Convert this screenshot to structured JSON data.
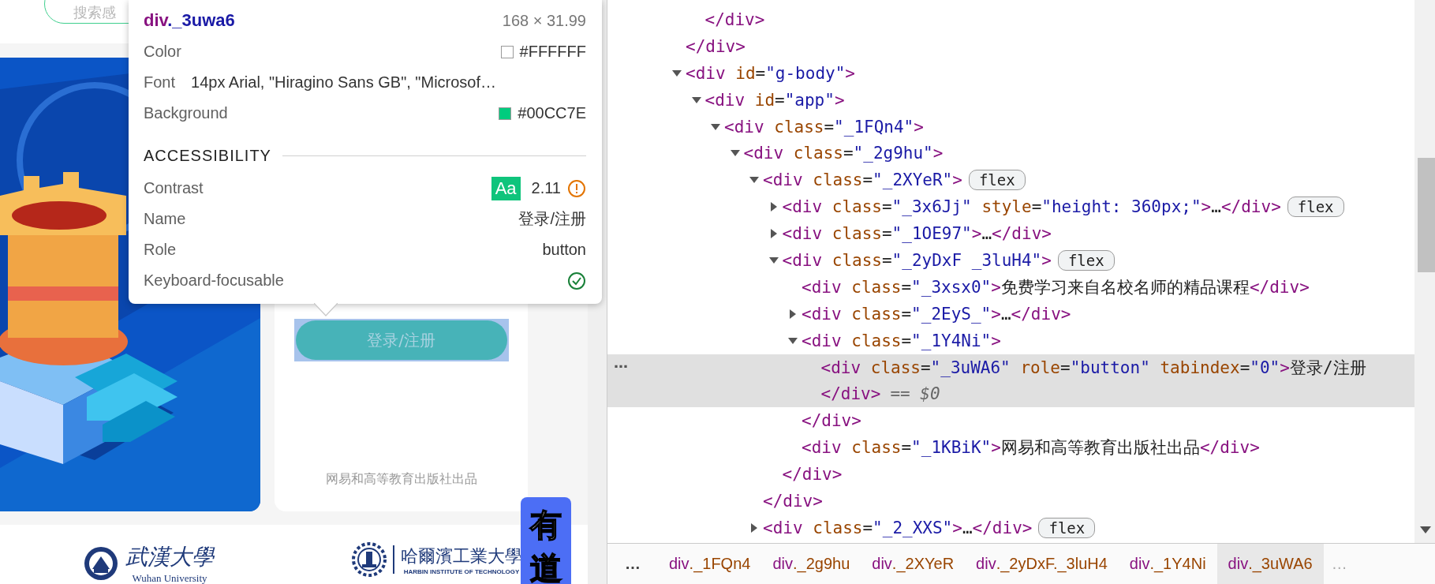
{
  "page": {
    "search": {
      "placeholder": "搜索感"
    },
    "login_card": {
      "button": "登录/注册",
      "footer": "网易和高等教育出版社出品"
    },
    "partners": [
      {
        "name": "武漢大學",
        "english": "Wuhan University"
      },
      {
        "name": "哈爾濱工業大學",
        "english": "HARBIN INSTITUTE OF TECHNOLOGY"
      }
    ],
    "side_tab": {
      "label": "有道"
    }
  },
  "tooltip": {
    "title": "div._3uwa6",
    "size": "168 × 31.99",
    "rows": [
      {
        "label": "Color",
        "kind": "swatch",
        "value": "#FFFFFF"
      },
      {
        "label": "Font",
        "kind": "text",
        "value": "14px Arial, \"Hiragino Sans GB\", \"Microsof…"
      },
      {
        "label": "Background",
        "kind": "swatch",
        "value": "#00CC7E"
      }
    ],
    "section": "ACCESSIBILITY",
    "a11y": [
      {
        "label": "Contrast",
        "kind": "contrast",
        "badge": "Aa",
        "value": "2.11",
        "warning": true
      },
      {
        "label": "Name",
        "kind": "text",
        "value": "登录/注册"
      },
      {
        "label": "Role",
        "kind": "text",
        "value": "button"
      },
      {
        "label": "Keyboard-focusable",
        "kind": "check",
        "checked": true
      }
    ]
  },
  "devtools": {
    "tree": [
      {
        "children": [
          {
            "end": "</div>"
          }
        ],
        "end": "</div>"
      },
      {
        "line": "<div id=\"g-body\">",
        "expanded": true,
        "selected": false,
        "children": [
          {
            "line": "<div id=\"app\">",
            "expanded": true,
            "selected": false,
            "children": [
              {
                "line": "<div class=\"_1FQn4\">",
                "expanded": true,
                "selected": false,
                "children": [
                  {
                    "line": "<div class=\"_2g9hu\">",
                    "expanded": true,
                    "selected": false,
                    "children": [
                      {
                        "line": "<div class=\"_2XYeR\">",
                        "expanded": true,
                        "badge": "flex",
                        "selected": false,
                        "children": [
                          {
                            "line": "<div class=\"_3x6Jj\" style=\"height: 360px;\">…</div>",
                            "expanded": false,
                            "badge": "flex",
                            "selected": false
                          },
                          {
                            "line": "<div class=\"_1OE97\">…</div>",
                            "expanded": false,
                            "selected": false
                          },
                          {
                            "line": "<div class=\"_2yDxF _3luH4\">",
                            "expanded": true,
                            "badge": "flex",
                            "selected": false,
                            "children": [
                              {
                                "line": "<div class=\"_3xsx0\">免费学习来自名校名师的精品课程</div>",
                                "selected": false
                              },
                              {
                                "line": "<div class=\"_2EyS_\">…</div>",
                                "expanded": false,
                                "selected": false
                              },
                              {
                                "line": "<div class=\"_1Y4Ni\">",
                                "expanded": true,
                                "selected": false,
                                "children": [
                                  {
                                    "line": "<div class=\"_3uWA6\" role=\"button\" tabindex=\"0\">登录/注册",
                                    "close": "</div>",
                                    "console_ref": "== $0",
                                    "menu": "…",
                                    "selected": true
                                  }
                                ],
                                "end": "</div>"
                              },
                              {
                                "line": "<div class=\"_1KBiK\">网易和高等教育出版社出品</div>",
                                "selected": false
                              }
                            ],
                            "end": "</div>"
                          }
                        ],
                        "end": "</div>"
                      },
                      {
                        "line": "<div class=\"_2_XXS\">…</div>",
                        "expanded": false,
                        "badge": "flex",
                        "selected": false
                      }
                    ]
                  }
                ]
              }
            ]
          }
        ]
      }
    ],
    "breadcrumbs": {
      "more_left": "…",
      "more_right": "…",
      "items": [
        {
          "label": "div._1FQn4",
          "selected": false
        },
        {
          "label": "div._2g9hu",
          "selected": false
        },
        {
          "label": "div._2XYeR",
          "selected": false
        },
        {
          "label": "div._2yDxF._3luH4",
          "selected": false
        },
        {
          "label": "div._1Y4Ni",
          "selected": false
        },
        {
          "label": "div._3uWA6",
          "selected": true
        }
      ]
    }
  }
}
